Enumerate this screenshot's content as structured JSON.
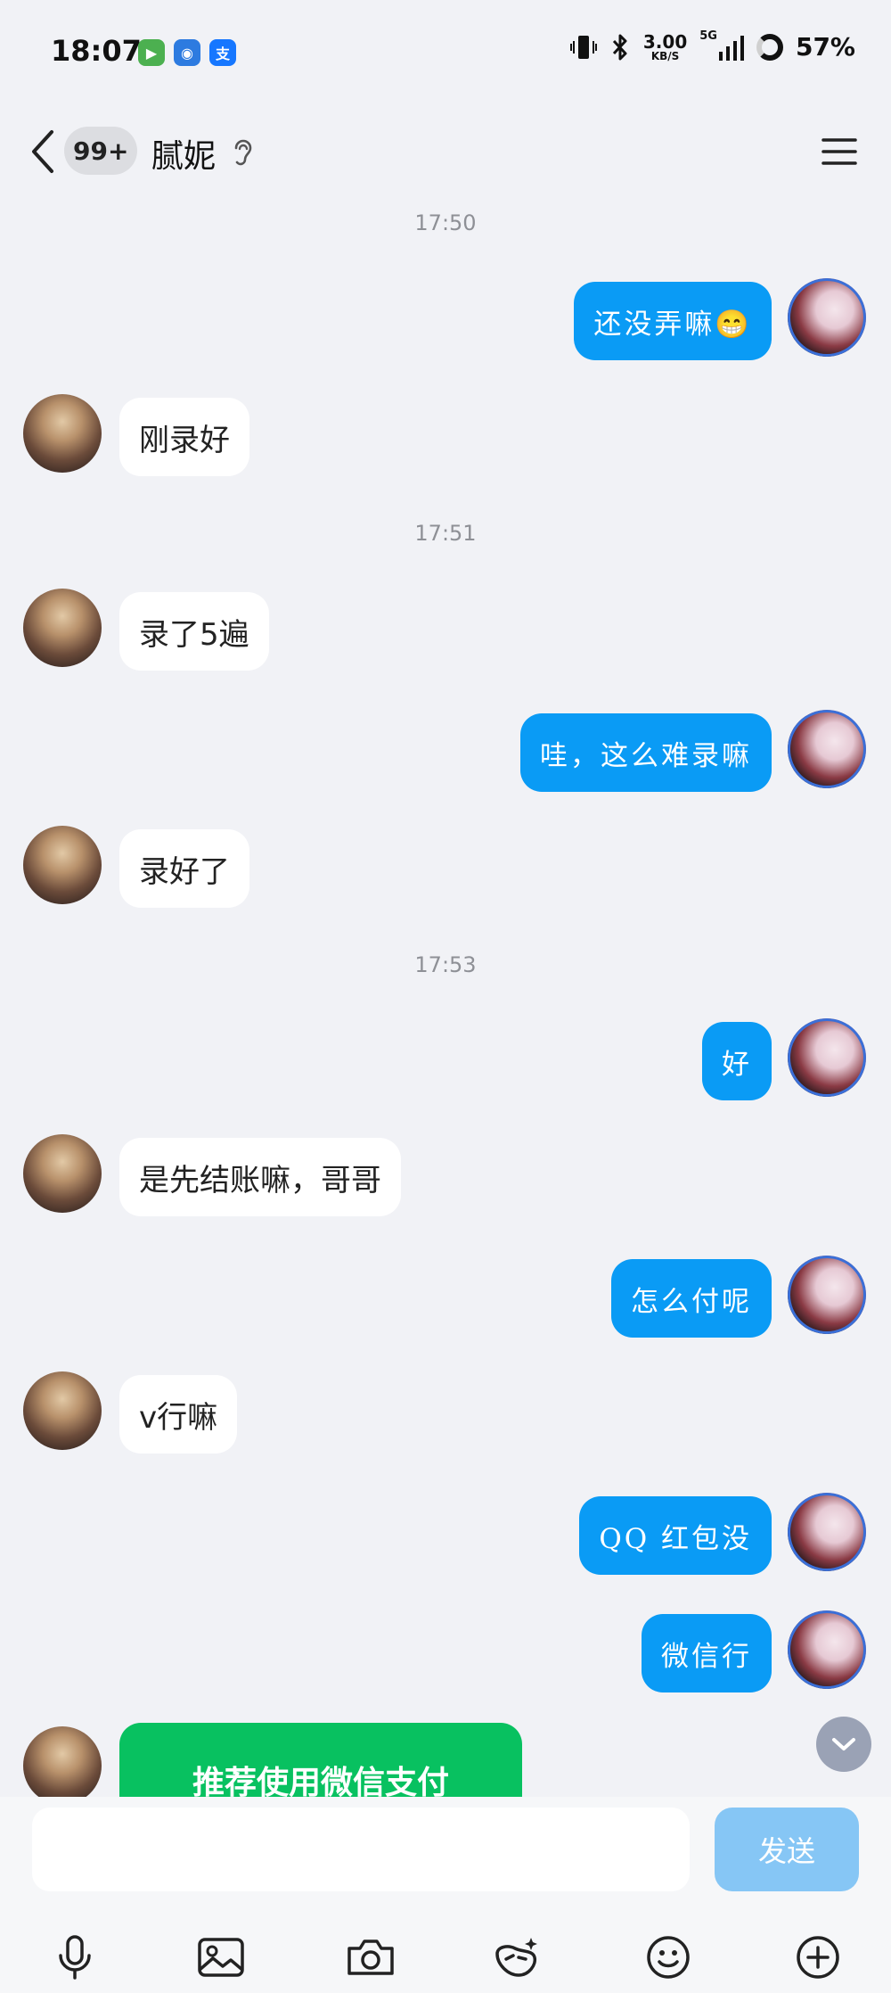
{
  "status_bar": {
    "time": "18:07",
    "app_icons": [
      {
        "name": "video-app-icon",
        "color": "#4cb050",
        "glyph": "▶"
      },
      {
        "name": "browser-app-icon",
        "color": "#2d7be0",
        "glyph": "◉"
      },
      {
        "name": "alipay-app-icon",
        "color": "#1677ff",
        "glyph": "支"
      }
    ],
    "net_speed_value": "3.00",
    "net_speed_unit": "KB/S",
    "signal_label": "5G",
    "battery": "57%"
  },
  "header": {
    "unread_badge": "99+",
    "contact_name": "腻妮"
  },
  "chat": {
    "timestamps": [
      "17:50",
      "17:51",
      "17:53"
    ],
    "messages": [
      {
        "side": "me",
        "text": "还没弄嘛😁"
      },
      {
        "side": "other",
        "text": "刚录好"
      },
      {
        "side": "other",
        "text": "录了5遍"
      },
      {
        "side": "me",
        "text": "哇，这么难录嘛"
      },
      {
        "side": "other",
        "text": "录好了"
      },
      {
        "side": "me",
        "text": "好"
      },
      {
        "side": "other",
        "text": "是先结账嘛，哥哥"
      },
      {
        "side": "me",
        "text": "怎么付呢"
      },
      {
        "side": "other",
        "text": "v行嘛"
      },
      {
        "side": "me",
        "text": "QQ 红包没"
      },
      {
        "side": "me",
        "text": "微信行"
      },
      {
        "side": "other",
        "text": "推荐使用微信支付"
      }
    ]
  },
  "input": {
    "placeholder": "",
    "send_label": "发送"
  },
  "colors": {
    "my_bubble": "#0a9bf5",
    "wechat_pay_card": "#08c160",
    "send_button_disabled": "#86c6f5"
  }
}
